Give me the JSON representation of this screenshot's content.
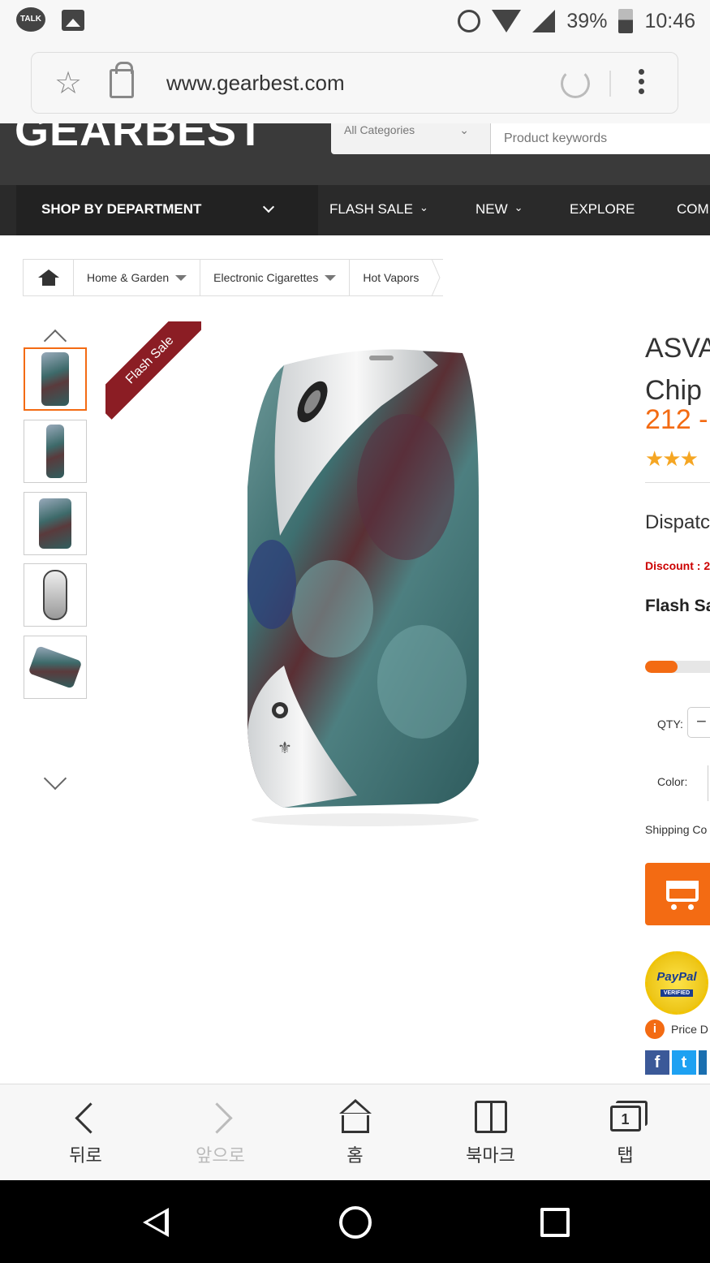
{
  "status_bar": {
    "talk_label": "TALK",
    "battery": "39%",
    "time": "10:46"
  },
  "browser": {
    "url": "www.gearbest.com"
  },
  "site": {
    "logo": "GEARBEST",
    "category_select": "All Categories",
    "search_placeholder": "Product keywords"
  },
  "nav": {
    "shop_by_department": "SHOP BY DEPARTMENT",
    "items": [
      {
        "label": "FLASH SALE",
        "caret": true
      },
      {
        "label": "NEW",
        "caret": true
      },
      {
        "label": "EXPLORE",
        "caret": false
      },
      {
        "label": "COMI",
        "caret": false
      }
    ]
  },
  "breadcrumb": [
    {
      "label": "Home & Garden",
      "dropdown": true
    },
    {
      "label": "Electronic Cigarettes",
      "dropdown": true
    },
    {
      "label": "Hot Vapors",
      "dropdown": false
    }
  ],
  "gallery": {
    "flash_ribbon": "Flash Sale",
    "thumbnail_count": 5,
    "active_thumbnail": 1
  },
  "product": {
    "title_line1": "ASVA",
    "title_line2": "Chip",
    "price": "212 -",
    "rating_stars": "★★★",
    "dispatch": "Dispatc",
    "discount": "Discount : 2",
    "flash_sale": "Flash Sa",
    "sold_progress": 0.5,
    "qty_label": "QTY:",
    "qty_button": "−",
    "color_label": "Color:",
    "shipping": "Shipping Co",
    "paypal_logo": "PayPal",
    "paypal_verified": "VERIFIED",
    "price_note": "Price D"
  },
  "colors": {
    "accent": "#f36b13",
    "header_bg": "#3a3a3a",
    "nav_bg": "#2a2a2a",
    "ribbon": "#8b1d24",
    "discount": "#cc0000",
    "facebook": "#3b5998",
    "twitter": "#1da1f2"
  },
  "bottom_bar": [
    {
      "label": "뒤로",
      "icon": "back-icon",
      "disabled": false
    },
    {
      "label": "앞으로",
      "icon": "forward-icon",
      "disabled": true
    },
    {
      "label": "홈",
      "icon": "home-icon",
      "disabled": false
    },
    {
      "label": "북마크",
      "icon": "bookmark-icon",
      "disabled": false
    },
    {
      "label": "탭",
      "icon": "tabs-icon",
      "disabled": false,
      "badge": "1"
    }
  ]
}
